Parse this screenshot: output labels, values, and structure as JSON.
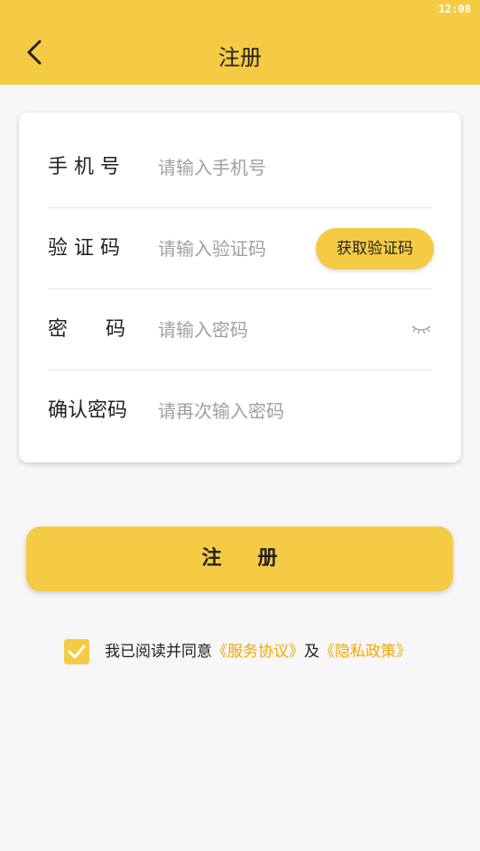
{
  "status_bar": {
    "time": "12:08"
  },
  "header": {
    "title": "注册",
    "back_icon": "chevron-left-icon"
  },
  "form": {
    "phone": {
      "label": "手 机 号",
      "placeholder": "请输入手机号",
      "value": ""
    },
    "code": {
      "label": "验 证 码",
      "placeholder": "请输入验证码",
      "value": "",
      "button_label": "获取验证码"
    },
    "password": {
      "label": "密      码",
      "placeholder": "请输入密码",
      "value": "",
      "toggle_icon": "eye-closed-icon"
    },
    "confirm": {
      "label": "确认密码",
      "placeholder": "请再次输入密码",
      "value": ""
    }
  },
  "register_button": {
    "label": "注册"
  },
  "agreement": {
    "checked": true,
    "prefix": "我已阅读并同意",
    "service_link": "《服务协议》",
    "middle": "及",
    "privacy_link": "《隐私政策》"
  },
  "colors": {
    "accent": "#f5cb45",
    "link": "#f2a900",
    "background": "#f7f6f9"
  }
}
